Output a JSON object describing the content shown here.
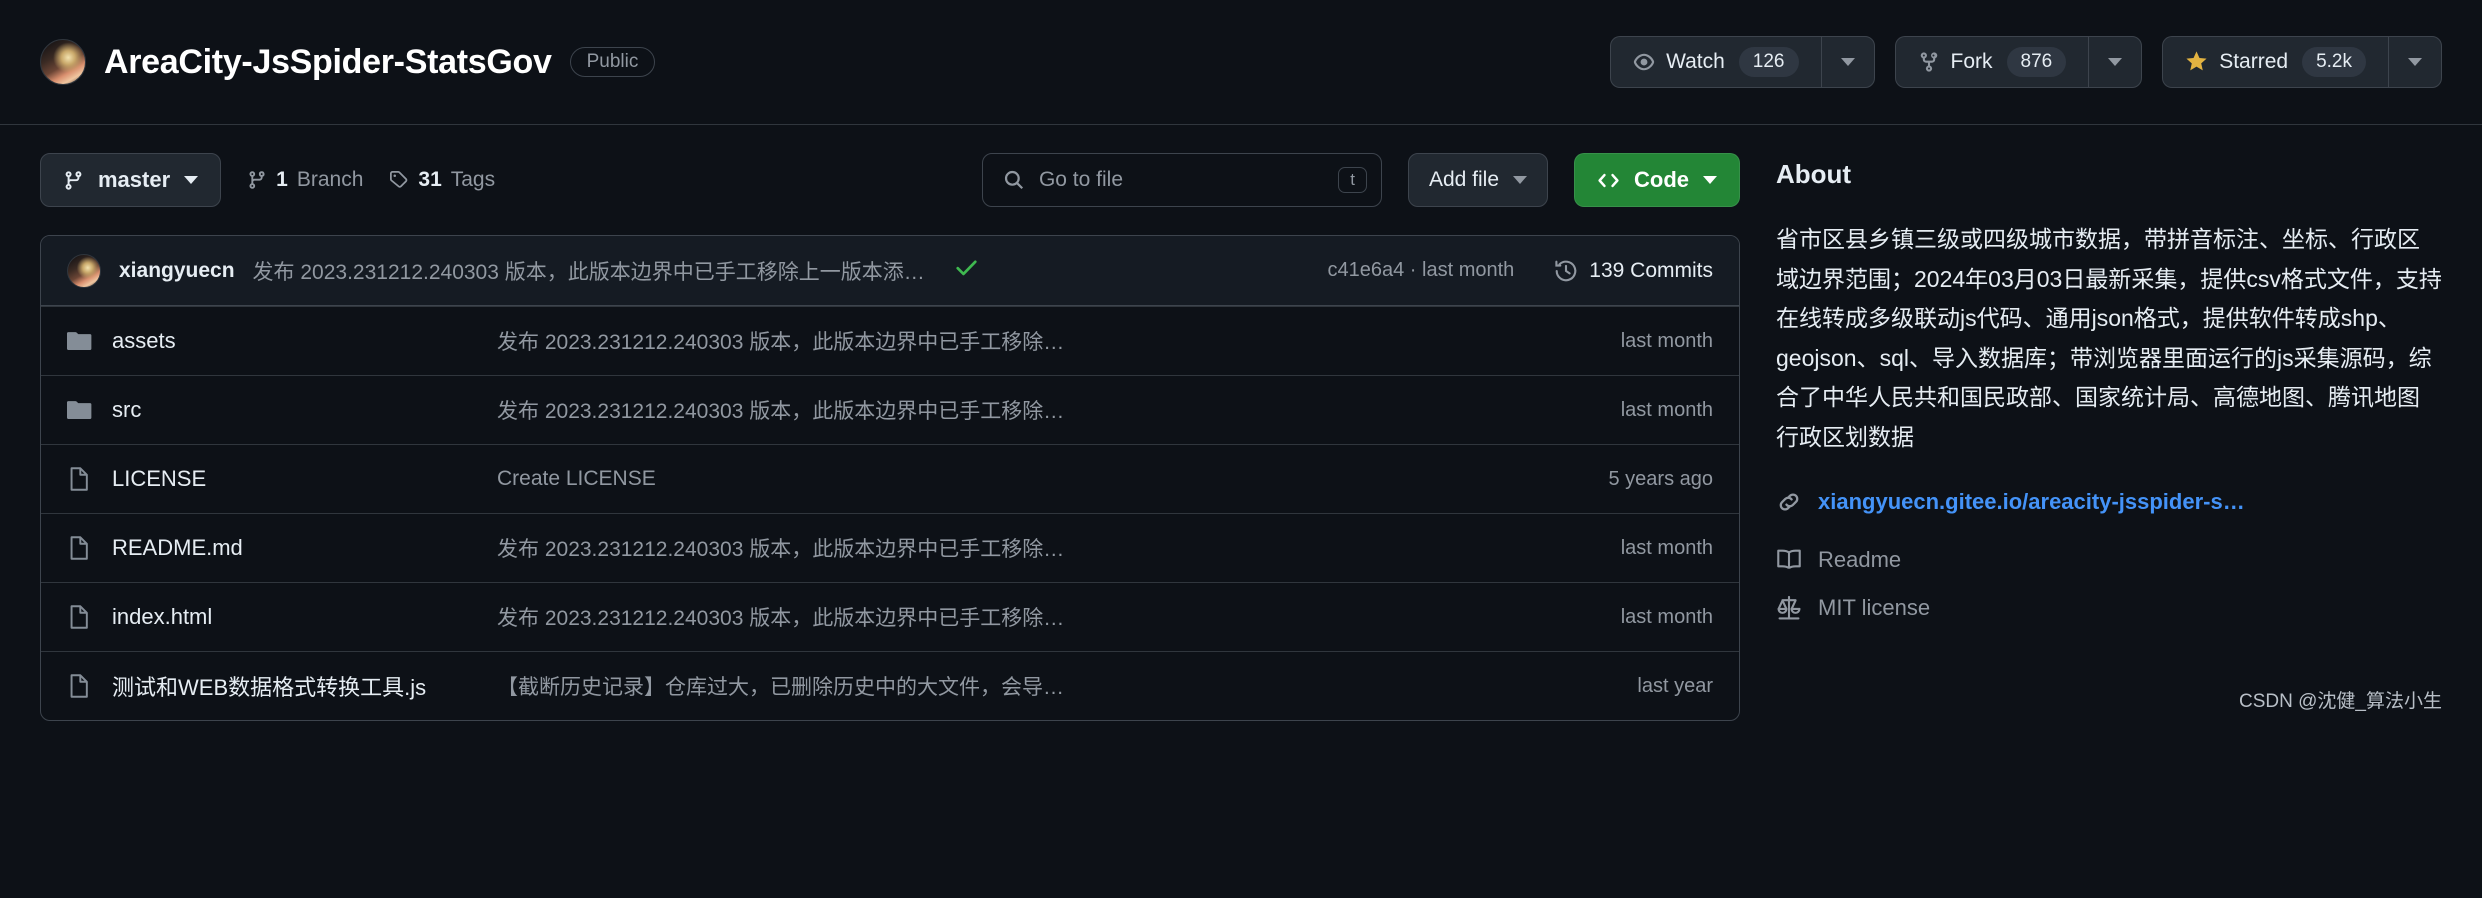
{
  "header": {
    "repo_name": "AreaCity-JsSpider-StatsGov",
    "visibility": "Public",
    "avatar_icon": "owner-avatar",
    "actions": [
      {
        "icon": "eye-icon",
        "label": "Watch",
        "count": "126"
      },
      {
        "icon": "fork-icon",
        "label": "Fork",
        "count": "876"
      },
      {
        "icon": "star-icon",
        "label": "Starred",
        "count": "5.2k"
      }
    ]
  },
  "toolbar": {
    "branch": "master",
    "branch_icon": "branch-icon",
    "branches_count": "1",
    "branches_label": "Branch",
    "tags_count": "31",
    "tags_label": "Tags",
    "tag_icon": "tag-icon",
    "search_placeholder": "Go to file",
    "search_icon": "search-icon",
    "search_kbd": "t",
    "add_file_label": "Add file",
    "code_label": "Code",
    "code_icon": "code-icon"
  },
  "commit_header": {
    "author": "xiangyuecn",
    "message": "发布 2023.231212.240303 版本，此版本边界中已手工移除上一版本添…",
    "status_icon": "check-icon",
    "sha": "c41e6a4",
    "sha_separator": "·",
    "sha_time": "last month",
    "commits_count": "139 Commits",
    "history_icon": "history-icon"
  },
  "files": [
    {
      "icon": "folder-icon",
      "name": "assets",
      "message": "发布 2023.231212.240303 版本，此版本边界中已手工移除…",
      "time": "last month"
    },
    {
      "icon": "folder-icon",
      "name": "src",
      "message": "发布 2023.231212.240303 版本，此版本边界中已手工移除…",
      "time": "last month"
    },
    {
      "icon": "file-icon",
      "name": "LICENSE",
      "message": "Create LICENSE",
      "time": "5 years ago"
    },
    {
      "icon": "file-icon",
      "name": "README.md",
      "message": "发布 2023.231212.240303 版本，此版本边界中已手工移除…",
      "time": "last month"
    },
    {
      "icon": "file-icon",
      "name": "index.html",
      "message": "发布 2023.231212.240303 版本，此版本边界中已手工移除…",
      "time": "last month"
    },
    {
      "icon": "file-icon",
      "name": "测试和WEB数据格式转换工具.js",
      "message": "【截断历史记录】仓库过大，已删除历史中的大文件，会导…",
      "time": "last year"
    }
  ],
  "about": {
    "title": "About",
    "description": "省市区县乡镇三级或四级城市数据，带拼音标注、坐标、行政区域边界范围；2024年03月03日最新采集，提供csv格式文件，支持在线转成多级联动js代码、通用json格式，提供软件转成shp、geojson、sql、导入数据库；带浏览器里面运行的js采集源码，综合了中华人民共和国民政部、国家统计局、高德地图、腾讯地图行政区划数据",
    "website": "xiangyuecn.gitee.io/areacity-jsspider-s…",
    "link_icon": "link-icon",
    "readme_label": "Readme",
    "readme_icon": "book-icon",
    "license_label": "MIT license",
    "license_icon": "law-icon"
  },
  "watermark": "CSDN @沈健_算法小生",
  "colors": {
    "background": "#0d1117",
    "border": "#3d444d",
    "muted_text": "#9198a1",
    "primary_text": "#e6edf3",
    "accent_green": "#238636",
    "link_blue": "#4493f8",
    "success_green": "#3fb950",
    "star_yellow": "#e3b341"
  }
}
